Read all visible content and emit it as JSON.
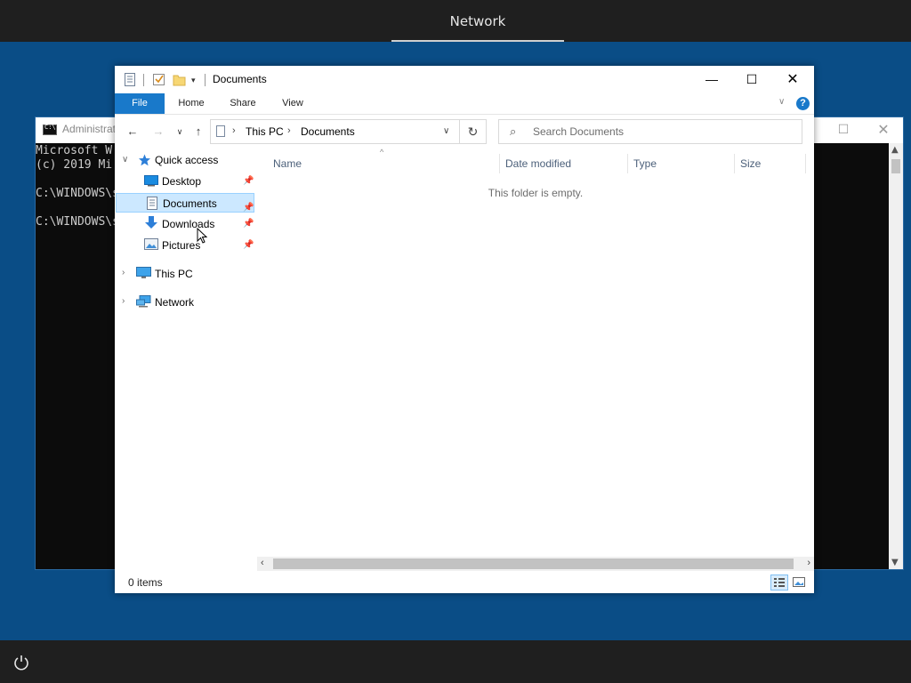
{
  "top_bar": {
    "title": "Network"
  },
  "cmd": {
    "title": "Administrat",
    "lines": [
      "Microsoft W",
      "(c) 2019 Mi",
      "",
      "C:\\WINDOWS\\s",
      "",
      "C:\\WINDOWS\\s"
    ]
  },
  "explorer": {
    "title": "Documents",
    "ribbon": {
      "file": "File",
      "home": "Home",
      "share": "Share",
      "view": "View",
      "help": "?"
    },
    "address": {
      "part1": "This PC",
      "part2": "Documents"
    },
    "search": {
      "placeholder": "Search Documents"
    },
    "tree": {
      "quick_access": "Quick access",
      "desktop": "Desktop",
      "documents": "Documents",
      "downloads": "Downloads",
      "pictures": "Pictures",
      "this_pc": "This PC",
      "network": "Network"
    },
    "columns": {
      "name": "Name",
      "date": "Date modified",
      "type": "Type",
      "size": "Size"
    },
    "empty_message": "This folder is empty.",
    "status": "0 items"
  },
  "colors": {
    "desktop": "#0a4d86",
    "accent": "#1979ca",
    "selection": "#cce8ff"
  },
  "icons": [
    "power-icon",
    "cmd-icon",
    "document-icon",
    "checkbox-icon",
    "folder-icon",
    "back-arrow-icon",
    "forward-arrow-icon",
    "up-arrow-icon",
    "refresh-icon",
    "search-icon",
    "star-icon",
    "desktop-icon",
    "download-icon",
    "pictures-icon",
    "monitor-icon",
    "network-icon",
    "pin-icon",
    "details-view-icon",
    "large-icons-view-icon"
  ]
}
